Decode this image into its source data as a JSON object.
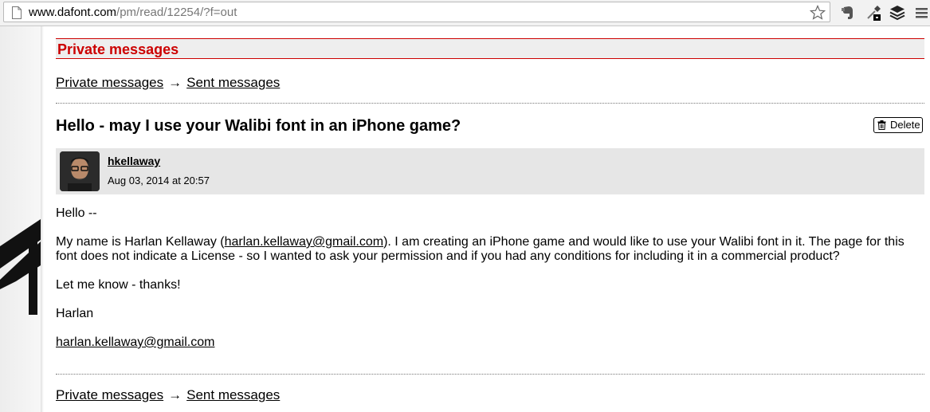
{
  "browser": {
    "url_domain": "www.dafont.com",
    "url_path": "/pm/read/12254/?f=out"
  },
  "header": {
    "title": "Private messages"
  },
  "breadcrumb": {
    "parent": "Private messages",
    "arrow": "→",
    "current": "Sent messages"
  },
  "message": {
    "subject": "Hello - may I use your Walibi font in an iPhone game?",
    "delete_label": "Delete",
    "author": "hkellaway",
    "date": "Aug 03, 2014 at 20:57",
    "greeting": "Hello --",
    "para_before_link": "My name is Harlan Kellaway (",
    "email_inline": "harlan.kellaway@gmail.com",
    "para_after_link": "). I am creating an iPhone game and would like to use your Walibi font in it. The page for this font does not indicate a License - so I wanted to ask your permission and if you had any conditions for including it in a commercial product?",
    "closing": "Let me know - thanks!",
    "signature": "Harlan",
    "signature_email": "harlan.kellaway@gmail.com"
  }
}
